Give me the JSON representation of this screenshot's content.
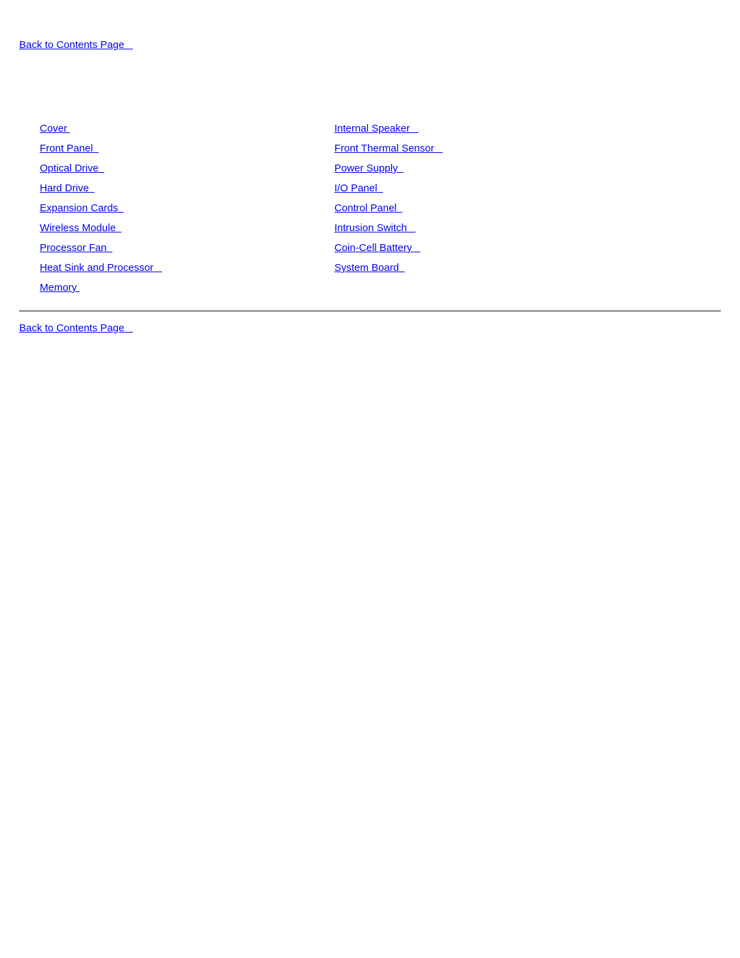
{
  "page": {
    "background_color": "#ffffff",
    "link_color": "#0000ee",
    "rule_color": "#a0a0a0"
  },
  "top_nav": {
    "back_to_contents_label": "Back to Contents Page   "
  },
  "bottom_nav": {
    "back_to_contents_label": "Back to Contents Page   "
  },
  "index": {
    "left_column": [
      {
        "label": "Cover "
      },
      {
        "label": "Front Panel  "
      },
      {
        "label": "Optical Drive  "
      },
      {
        "label": "Hard Drive  "
      },
      {
        "label": "Expansion Cards  "
      },
      {
        "label": "Wireless Module  "
      },
      {
        "label": "Processor Fan  "
      },
      {
        "label": "Heat Sink and Processor   "
      },
      {
        "label": "Memory "
      }
    ],
    "right_column": [
      {
        "label": "Internal Speaker   "
      },
      {
        "label": "Front Thermal Sensor   "
      },
      {
        "label": "Power Supply  "
      },
      {
        "label": "I/O Panel  "
      },
      {
        "label": "Control Panel  "
      },
      {
        "label": "Intrusion Switch   "
      },
      {
        "label": "Coin-Cell Battery   "
      },
      {
        "label": "System Board  "
      }
    ]
  }
}
